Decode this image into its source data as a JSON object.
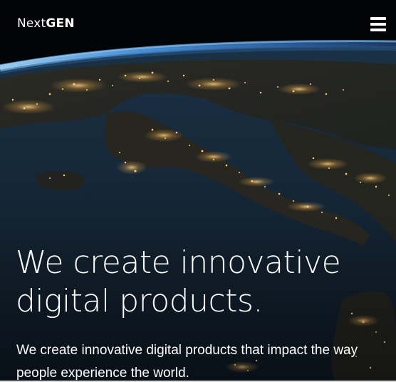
{
  "header": {
    "logo_light": "Next",
    "logo_bold": "GEN",
    "menu_icon": "hamburger-menu-icon"
  },
  "hero": {
    "headline": "We create innovative digital products.",
    "subheadline": "We create innovative digital products that impact the way people experience the world.",
    "background": "earth-at-night-from-space"
  },
  "colors": {
    "text": "#ffffff",
    "space": "#04060a",
    "ocean": "#142433",
    "atmosphere": "#5fa8f0",
    "city_lights": "#f3c46a"
  }
}
